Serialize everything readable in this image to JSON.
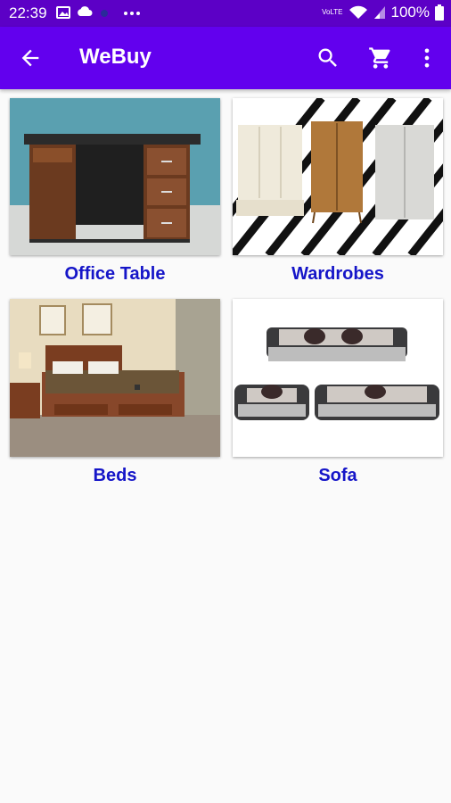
{
  "status_bar": {
    "time": "22:39",
    "network": "VoLTE",
    "battery": "100%"
  },
  "app_bar": {
    "title": "WeBuy",
    "icons": [
      "back-arrow-icon",
      "search-icon",
      "cart-icon",
      "more-vert-icon"
    ]
  },
  "categories": [
    {
      "label": "Office Table",
      "image": "office-table-image"
    },
    {
      "label": "Wardrobes",
      "image": "wardrobes-image"
    },
    {
      "label": "Beds",
      "image": "beds-image"
    },
    {
      "label": "Sofa",
      "image": "sofa-image"
    }
  ],
  "colors": {
    "status_bar": "#5c00c6",
    "app_bar": "#6200ee",
    "label_text": "#1515c8",
    "background": "#fafafa"
  }
}
